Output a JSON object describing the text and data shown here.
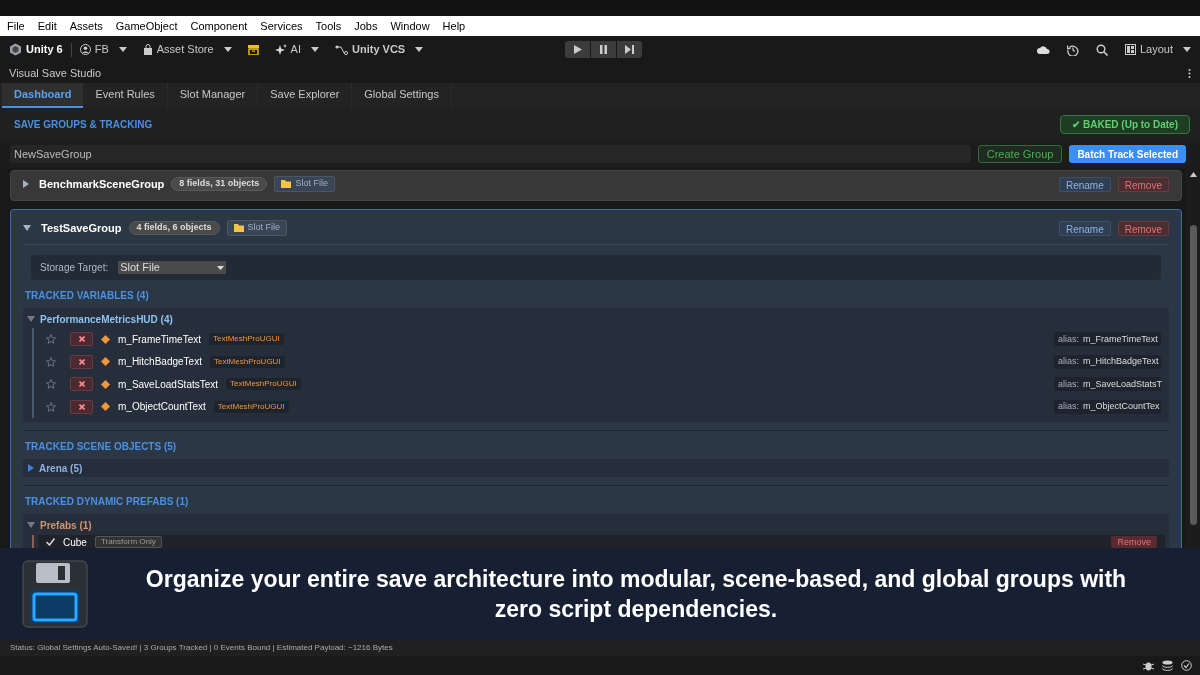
{
  "menu_bar": [
    "File",
    "Edit",
    "Assets",
    "GameObject",
    "Component",
    "Services",
    "Tools",
    "Jobs",
    "Window",
    "Help"
  ],
  "toolbar": {
    "account": "Unity 6",
    "user": "FB",
    "left_items": [
      {
        "kind": "store",
        "label": "Asset Store"
      },
      {
        "kind": "package"
      },
      {
        "kind": "ai",
        "label": "AI"
      },
      {
        "kind": "vcs",
        "label": "Unity VCS"
      }
    ],
    "layout": "Layout"
  },
  "window": {
    "title": "Visual Save Studio"
  },
  "tabs": [
    {
      "label": "Dashboard",
      "selected": true
    },
    {
      "label": "Event Rules",
      "selected": false
    },
    {
      "label": "Slot Manager",
      "selected": false
    },
    {
      "label": "Save Explorer",
      "selected": false
    },
    {
      "label": "Global Settings",
      "selected": false
    }
  ],
  "header": {
    "title": "SAVE GROUPS & TRACKING",
    "status": "✔ BAKED (Up to Date)"
  },
  "new_group": {
    "value": "NewSaveGroup",
    "create": "Create Group",
    "batch": "Batch Track Selected"
  },
  "groups": [
    {
      "name": "BenchmarkSceneGroup",
      "counts": "8 fields, 31 objects",
      "storage": "Slot File",
      "expanded": false,
      "rename": "Rename",
      "remove": "Remove"
    },
    {
      "name": "TestSaveGroup",
      "counts": "4 fields, 6 objects",
      "storage": "Slot File",
      "expanded": true,
      "rename": "Rename",
      "remove": "Remove",
      "storage_label": "Storage Target:",
      "storage_value": "Slot File",
      "variables": {
        "title": "TRACKED VARIABLES (4)",
        "component": "PerformanceMetricsHUD (4)",
        "expanded": true,
        "fields": [
          {
            "name": "m_FrameTimeText",
            "type": "TextMeshProUGUI",
            "alias_label": "alias:",
            "alias": "m_FrameTimeText",
            "starred": false
          },
          {
            "name": "m_HitchBadgeText",
            "type": "TextMeshProUGUI",
            "alias_label": "alias:",
            "alias": "m_HitchBadgeText",
            "starred": false
          },
          {
            "name": "m_SaveLoadStatsText",
            "type": "TextMeshProUGUI",
            "alias_label": "alias:",
            "alias": "m_SaveLoadStatsT",
            "starred": false
          },
          {
            "name": "m_ObjectCountText",
            "type": "TextMeshProUGUI",
            "alias_label": "alias:",
            "alias": "m_ObjectCountTex",
            "starred": false
          }
        ]
      },
      "scene_objects": {
        "title": "TRACKED SCENE OBJECTS (5)",
        "items": [
          {
            "label": "Arena (5)",
            "expanded": false
          }
        ]
      },
      "prefabs": {
        "title": "TRACKED DYNAMIC PREFABS (1)",
        "label": "Prefabs (1)",
        "expanded": true,
        "items": [
          {
            "name": "Cube",
            "checked": true,
            "mode": "Transform Only",
            "remove": "Remove"
          }
        ]
      }
    }
  ],
  "banner": {
    "text": "Organize your entire save architecture into modular, scene-based, and global groups with zero script dependencies."
  },
  "status_bar": "Status: Global Settings Auto-Saved! | 3 Groups Tracked | 0 Events Bound | Estimated Payload: ~1216 Bytes"
}
